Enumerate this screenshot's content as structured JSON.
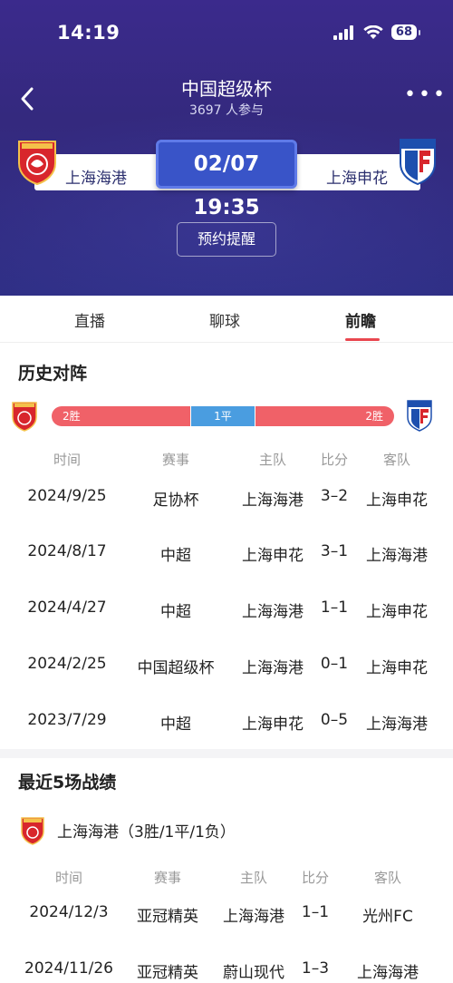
{
  "status_bar": {
    "time": "14:19",
    "battery": "68"
  },
  "header": {
    "title": "中国超级杯",
    "subtitle": "3697 人参与",
    "home_team": "上海海港",
    "away_team": "上海申花",
    "kickoff": "02/07 19:35",
    "remind_label": "预约提醒"
  },
  "tabs": [
    {
      "label": "直播"
    },
    {
      "label": "聊球"
    },
    {
      "label": "前瞻"
    }
  ],
  "history": {
    "title": "历史对阵",
    "bar": {
      "home": "2胜",
      "draw": "1平",
      "away": "2胜"
    },
    "record_values": {
      "home_wins": 2,
      "draws": 1,
      "away_wins": 2
    },
    "columns": [
      "时间",
      "赛事",
      "主队",
      "比分",
      "客队"
    ],
    "rows": [
      {
        "date": "2024/9/25",
        "comp": "足协杯",
        "home": "上海海港",
        "score": "3–2",
        "away": "上海申花"
      },
      {
        "date": "2024/8/17",
        "comp": "中超",
        "home": "上海申花",
        "score": "3–1",
        "away": "上海海港"
      },
      {
        "date": "2024/4/27",
        "comp": "中超",
        "home": "上海海港",
        "score": "1–1",
        "away": "上海申花"
      },
      {
        "date": "2024/2/25",
        "comp": "中国超级杯",
        "home": "上海海港",
        "score": "0–1",
        "away": "上海申花"
      },
      {
        "date": "2023/7/29",
        "comp": "中超",
        "home": "上海申花",
        "score": "0–5",
        "away": "上海海港"
      }
    ]
  },
  "recent": {
    "title": "最近5场战绩",
    "team_record": "上海海港（3胜/1平/1负）",
    "columns": [
      "时间",
      "赛事",
      "主队",
      "比分",
      "客队"
    ],
    "rows": [
      {
        "date": "2024/12/3",
        "comp": "亚冠精英",
        "home": "上海海港",
        "score": "1–1",
        "away": "光州FC"
      },
      {
        "date": "2024/11/26",
        "comp": "亚冠精英",
        "home": "蔚山现代",
        "score": "1–3",
        "away": "上海海港"
      }
    ]
  },
  "colors": {
    "accent_red": "#e9474f",
    "win_red": "#f06168",
    "draw_blue": "#4a9de0",
    "hero_purple": "#34297e",
    "time_blue": "#3954c8"
  },
  "icons": {
    "back": "chevron-left-icon",
    "more": "more-dots-icon",
    "signal": "signal-icon",
    "wifi": "wifi-icon"
  }
}
